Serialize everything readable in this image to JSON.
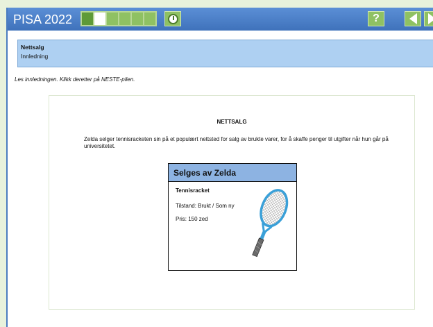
{
  "header": {
    "brand": "PISA 2022",
    "progress": {
      "total": 6,
      "completed": 1,
      "current": 2
    }
  },
  "unit": {
    "title": "Nettsalg",
    "subtitle": "Innledning"
  },
  "instruction": "Les innledningen. Klikk deretter på NESTE-pilen.",
  "stimulus": {
    "title": "NETTSALG",
    "body": "Zelda selger tennisracketen sin på et populært nettsted for salg av brukte varer, for å skaffe penger til utgifter når hun går på universitetet.",
    "listing": {
      "header": "Selges av Zelda",
      "item_name": "Tennisracket",
      "condition": "Tilstand: Brukt / Som ny",
      "price": "Pris: 150 zed"
    }
  },
  "icons": {
    "help": "?",
    "timer": "clock-icon",
    "back": "back-arrow-icon",
    "next": "next-arrow-icon"
  },
  "colors": {
    "topbar": "#4a7cbf",
    "progress_done": "#5e9a38",
    "listing_header": "#8db3e2",
    "unit_header": "#aed0f2",
    "racket_frame": "#3aa0d8"
  }
}
